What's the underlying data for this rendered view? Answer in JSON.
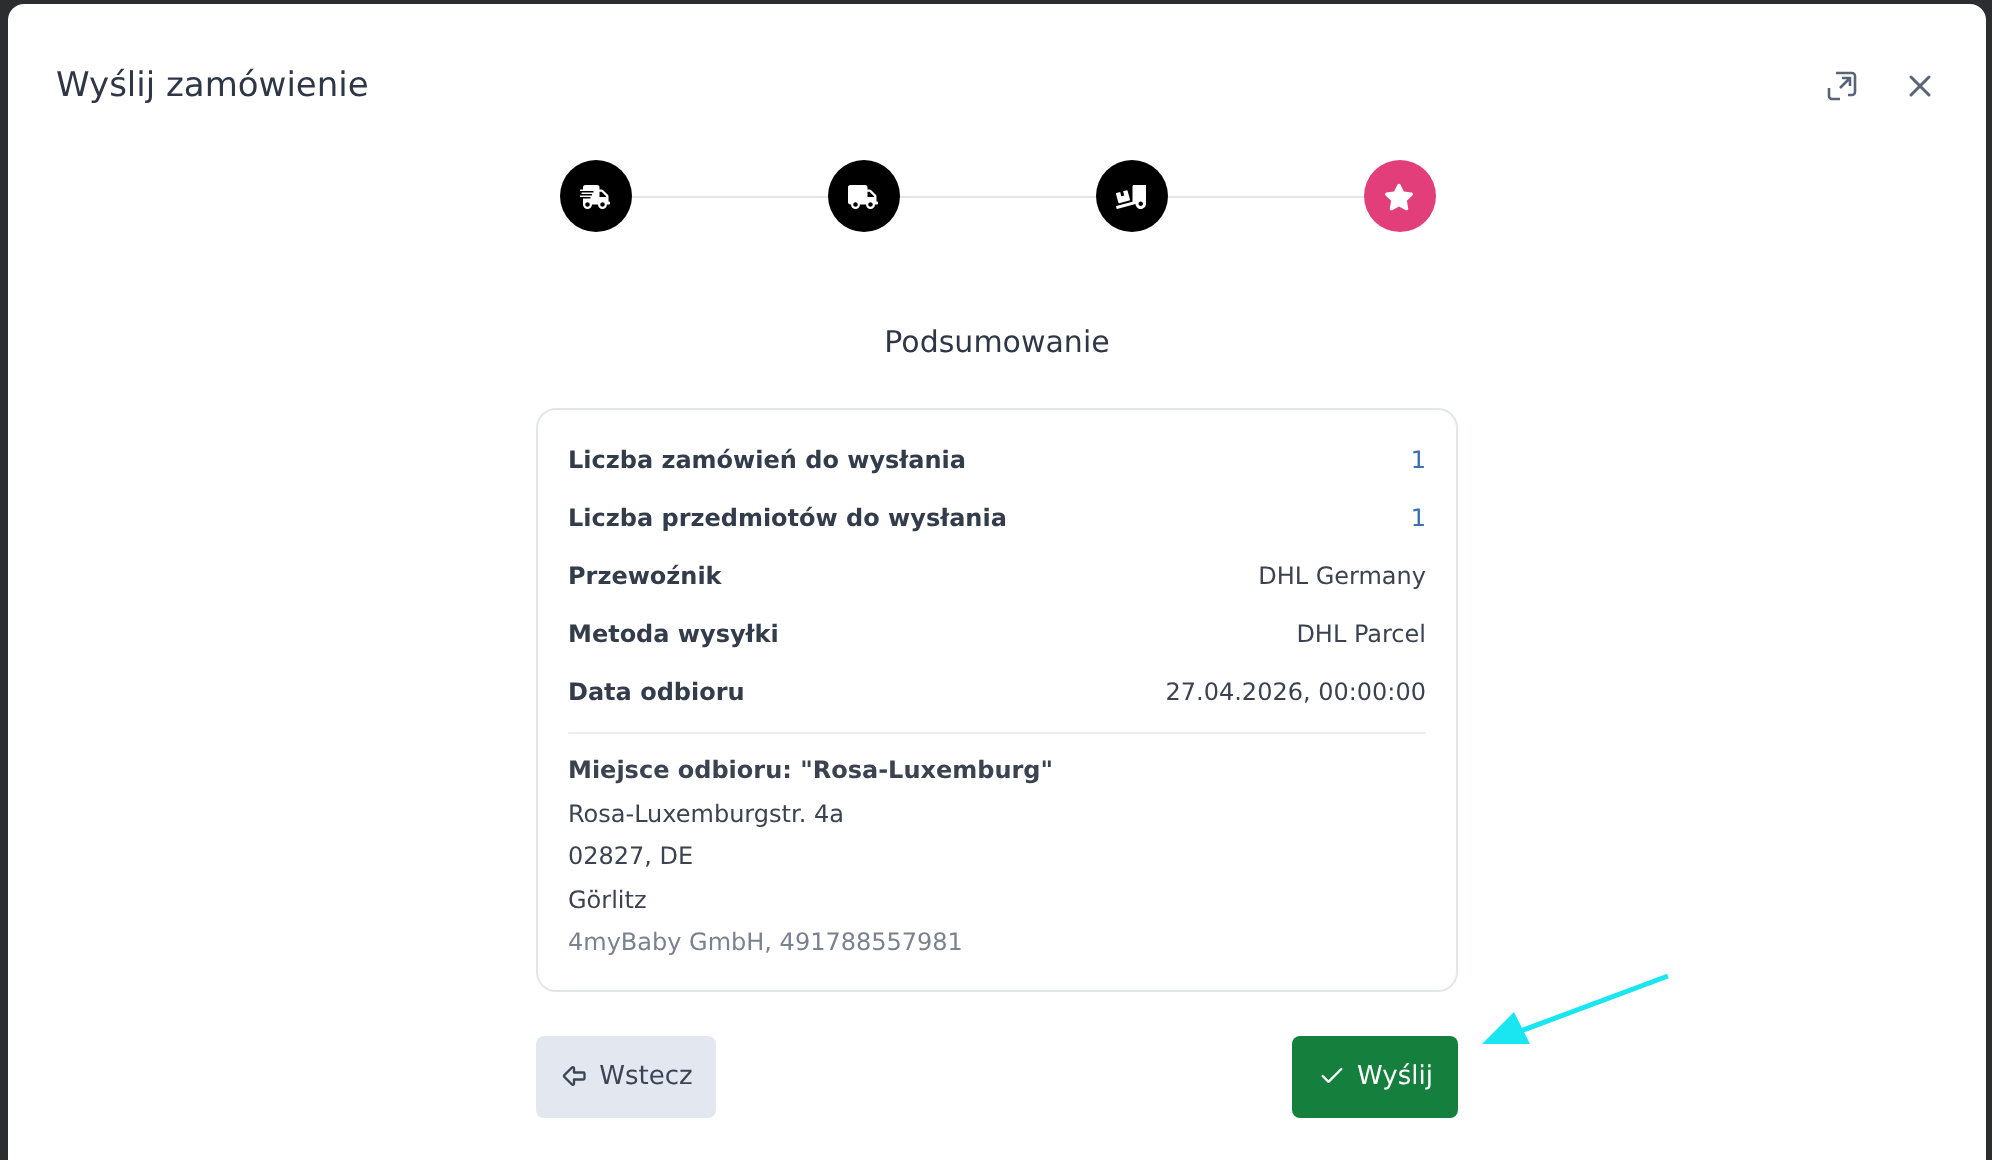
{
  "dialog": {
    "title": "Wyślij zamówienie"
  },
  "steps": [
    {
      "kind": "fast-truck",
      "selected": false
    },
    {
      "kind": "truck",
      "selected": false
    },
    {
      "kind": "dolly",
      "selected": false
    },
    {
      "kind": "star",
      "selected": true
    }
  ],
  "summary": {
    "heading": "Podsumowanie",
    "rows": [
      {
        "label": "Liczba zamówień do wysłania",
        "value": "1",
        "kind": "count"
      },
      {
        "label": "Liczba przedmiotów do wysłania",
        "value": "1",
        "kind": "count"
      },
      {
        "label": "Przewoźnik",
        "value": "DHL Germany",
        "kind": "text"
      },
      {
        "label": "Metoda wysyłki",
        "value": "DHL Parcel",
        "kind": "text"
      },
      {
        "label": "Data odbioru",
        "value": "27.04.2026, 00:00:00",
        "kind": "text"
      }
    ],
    "pickup": {
      "title": "Miejsce odbioru: \"Rosa-Luxemburg\"",
      "lines": [
        "Rosa-Luxemburgstr. 4a",
        "02827, DE",
        "Görlitz"
      ],
      "contact": "4myBaby GmbH, 491788557981"
    }
  },
  "buttons": {
    "back": "Wstecz",
    "send": "Wyślij"
  }
}
